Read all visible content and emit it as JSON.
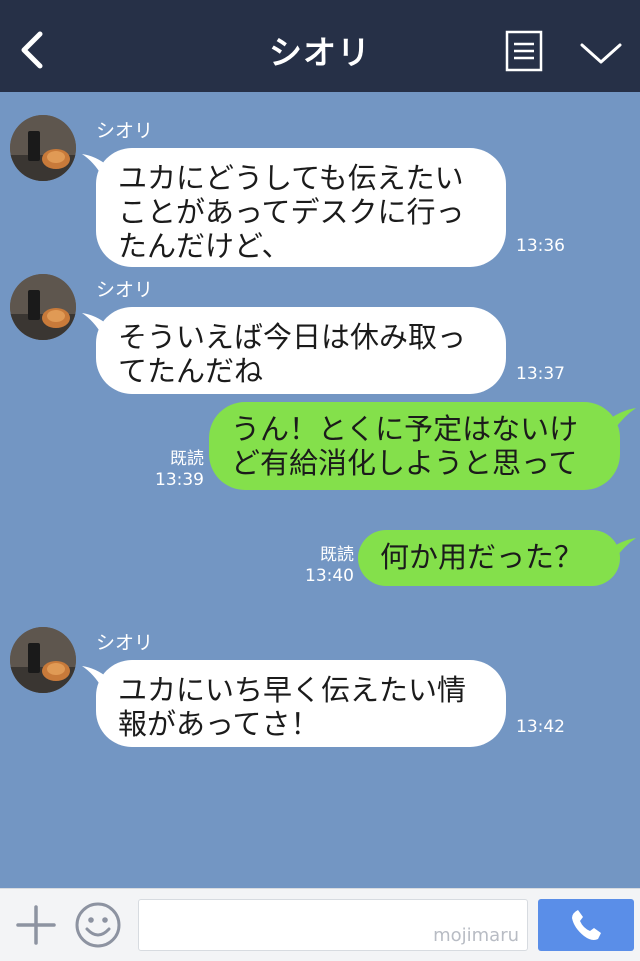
{
  "header": {
    "title": "シオリ",
    "icons": [
      "back-arrow-icon",
      "menu-list-icon",
      "chevron-down-icon"
    ]
  },
  "messages": [
    {
      "sender": "シオリ",
      "text": "ユカにどうしても伝えたい\nことがあってデスクに行っ\nたんだけど、",
      "time": "13:36"
    },
    {
      "sender": "シオリ",
      "text": "そういえば今日は休み取っ\nてたんだね",
      "time": "13:37"
    },
    {
      "text": "うん！とくに予定はないけ\nど有給消化しようと思って",
      "read": "既読",
      "time": "13:39"
    },
    {
      "text": "何か用だった？",
      "read": "既読",
      "time": "13:40"
    },
    {
      "sender": "シオリ",
      "text": "ユカにいち早く伝えたい情\n報があってさ！",
      "time": "13:42"
    }
  ],
  "input": {
    "watermark": "mojimaru",
    "icons": [
      "plus-icon",
      "smiley-icon",
      "phone-icon"
    ]
  },
  "colors": {
    "header_bg": "#263047",
    "chat_bg": "#7396c3",
    "incoming_bubble": "#ffffff",
    "outgoing_bubble": "#84e04b",
    "call_button": "#5a8ee8"
  }
}
